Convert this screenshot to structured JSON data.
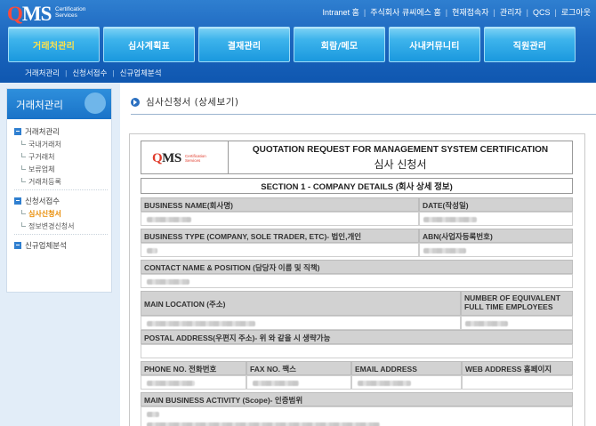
{
  "header": {
    "logo": {
      "text_main": "QMS",
      "text_sub_line1": "Certification",
      "text_sub_line2": "Services"
    },
    "top_links": [
      "Intranet 홈",
      "주식회사 큐씨에스 홈",
      "현재접속자",
      "관리자",
      "QCS",
      "로그아웃"
    ],
    "tabs": [
      {
        "label": "거래처관리",
        "active": true
      },
      {
        "label": "심사계획표",
        "active": false
      },
      {
        "label": "결재관리",
        "active": false
      },
      {
        "label": "회람/메모",
        "active": false
      },
      {
        "label": "사내커뮤니티",
        "active": false
      },
      {
        "label": "직원관리",
        "active": false
      }
    ],
    "subnav": [
      "거래처관리",
      "신청서접수",
      "신규업체분석"
    ]
  },
  "sidebar": {
    "title": "거래처관리",
    "groups": [
      {
        "label": "거래처관리",
        "items": [
          {
            "label": "국내거래처"
          },
          {
            "label": "구거래처"
          },
          {
            "label": "보류업체"
          },
          {
            "label": "거래처등록"
          }
        ]
      },
      {
        "label": "신청서접수",
        "items": [
          {
            "label": "심사신청서",
            "active": true
          },
          {
            "label": "정보변경신청서"
          }
        ]
      },
      {
        "label": "신규업체분석",
        "items": []
      }
    ]
  },
  "main": {
    "page_title": "심사신청서 (상세보기)",
    "form": {
      "logo": {
        "text_main": "QMS",
        "text_sub_line1": "Certification",
        "text_sub_line2": "Services"
      },
      "title_en": "QUOTATION REQUEST FOR MANAGEMENT SYSTEM CERTIFICATION",
      "title_ko": "심사 신청서",
      "section1": "SECTION 1 - COMPANY DETAILS (회사 상세 정보)",
      "labels": {
        "business_name": "BUSINESS NAME(회사명)",
        "date": "DATE(작성일)",
        "business_type": "BUSINESS TYPE (COMPANY, SOLE TRADER, ETC)- 법인,개인",
        "abn": "ABN(사업자등록번호)",
        "contact": "CONTACT NAME & POSITION (담당자 이름 및 직책)",
        "main_location": "MAIN LOCATION (주소)",
        "employees_1": "NUMBER OF EQUIVALENT",
        "employees_2": "FULL TIME EMPLOYEES",
        "postal": "POSTAL ADDRESS(우편지 주소)- 위 와 같을 시 생략가능",
        "phone": "PHONE NO. 전화번호",
        "fax": "FAX NO. 팩스",
        "email": "EMAIL ADDRESS",
        "web": "WEB ADDRESS 홈페이지",
        "activity": "MAIN BUSINESS ACTIVITY (Scope)- 인증범위"
      }
    }
  }
}
